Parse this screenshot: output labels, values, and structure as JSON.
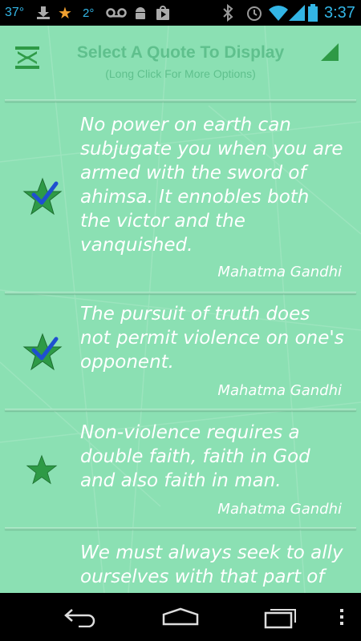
{
  "status_bar": {
    "temperature": "37°",
    "count": "2°",
    "time": "3:37",
    "icons": [
      "download-icon",
      "star-icon",
      "voicemail-icon",
      "android-icon",
      "play-store-icon",
      "bluetooth-icon",
      "alarm-icon",
      "wifi-icon",
      "signal-icon",
      "battery-icon"
    ]
  },
  "header": {
    "title": "Select A Quote To Display",
    "subtitle": "(Long Click For More Options)"
  },
  "quotes": [
    {
      "text": "No power on earth can\nsubjugate you when you are\narmed with the sword of\nahimsa.  It ennobles both\nthe victor and the\nvanquished.",
      "author": "Mahatma Gandhi",
      "checked": true
    },
    {
      "text": "The pursuit of truth does\nnot permit violence on one's\nopponent.",
      "author": "Mahatma Gandhi",
      "checked": true
    },
    {
      "text": "Non-violence requires a\ndouble faith, faith in God\nand also faith in man.",
      "author": "Mahatma Gandhi",
      "checked": false
    },
    {
      "text": "We must always seek to ally\nourselves with that part of",
      "author": "",
      "checked": false
    }
  ],
  "colors": {
    "background": "#8be0b3",
    "header_text": "#5fc08d",
    "star": "#2e9a46",
    "check": "#1e4fd0"
  },
  "nav_icons": [
    "back-icon",
    "home-icon",
    "recent-apps-icon",
    "overflow-menu-icon"
  ]
}
